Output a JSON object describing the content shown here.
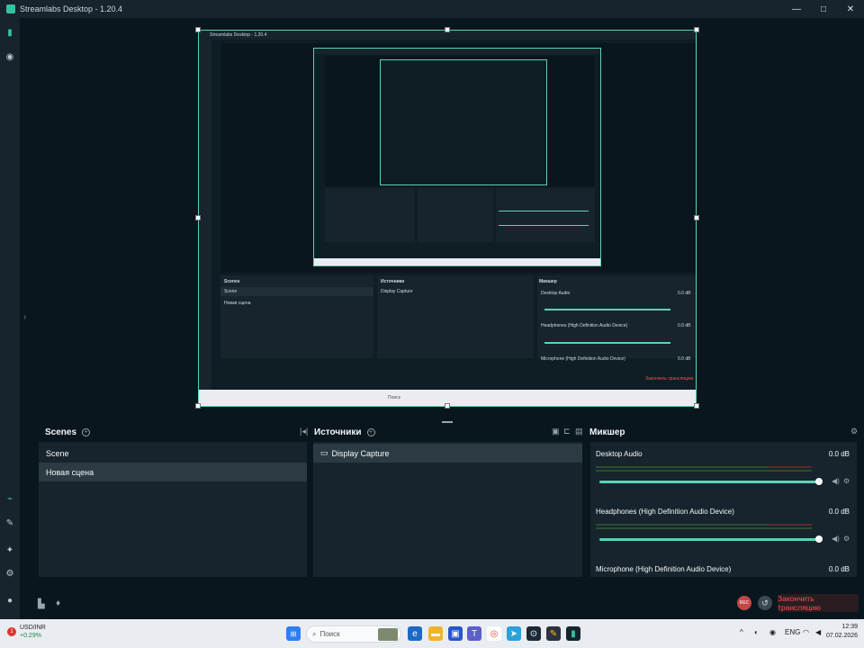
{
  "window": {
    "title": "Streamlabs Desktop - 1.20.4"
  },
  "window_controls": {
    "minimize": "—",
    "maximize": "□",
    "close": "✕"
  },
  "preview": {
    "nested_title": "Streamlabs Desktop - 1.20.4",
    "nested_scenes": [
      "Scene",
      "Новая сцена"
    ],
    "nested_sources": [
      "Display Capture"
    ],
    "nested_audio": [
      {
        "name": "Desktop Audio",
        "db": "0.0 dB"
      },
      {
        "name": "Headphones (High Definition Audio Device)",
        "db": "0.0 dB"
      },
      {
        "name": "Microphone (High Definition Audio Device)",
        "db": "0.0 dB"
      }
    ],
    "nested_headers": {
      "scenes": "Scenes",
      "sources": "Источники",
      "mixer": "Микшер"
    },
    "nested_go_live": "Закончить трансляцию",
    "nested_search": "Поиск"
  },
  "scenes": {
    "title": "Scenes",
    "items": [
      {
        "label": "Scene",
        "selected": false
      },
      {
        "label": "Новая сцена",
        "selected": true
      }
    ]
  },
  "sources": {
    "title": "Источники",
    "items": [
      {
        "label": "Display Capture",
        "icon": "monitor-icon"
      }
    ]
  },
  "mixer": {
    "title": "Микшер",
    "channels": [
      {
        "name": "Desktop Audio",
        "db": "0.0 dB",
        "volume": 1.0
      },
      {
        "name": "Headphones (High Definition Audio Device)",
        "db": "0.0 dB",
        "volume": 1.0
      },
      {
        "name": "Microphone (High Definition Audio Device)",
        "db": "0.0 dB",
        "volume": 1.0
      }
    ]
  },
  "footer": {
    "rec_label": "REC",
    "go_live_label": "Закончить трансляцию"
  },
  "taskbar": {
    "ticker_badge": "1",
    "ticker_symbol": "USD/INR",
    "ticker_change": "+0.29%",
    "search_placeholder": "Поиск",
    "language": "ENG",
    "time": "12:39",
    "date": "07.02.2026"
  },
  "colors": {
    "accent": "#31c3a2",
    "background": "#09161d",
    "panel": "#17242d",
    "danger": "#ff4d55"
  }
}
